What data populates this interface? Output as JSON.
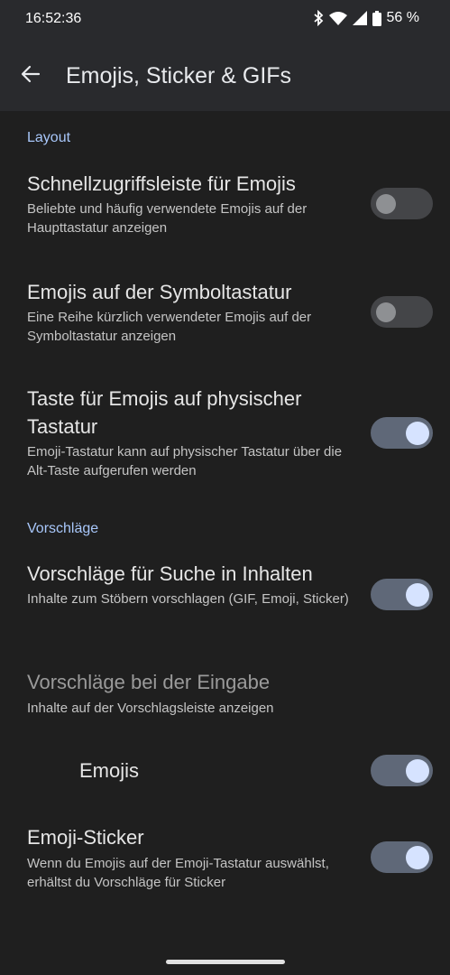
{
  "status": {
    "time": "16:52:36",
    "battery": "56 %",
    "icons": [
      "bluetooth-icon",
      "wifi-icon",
      "signal-icon",
      "battery-icon"
    ]
  },
  "appbar": {
    "title": "Emojis, Sticker & GIFs",
    "back_icon": "arrow-back-icon"
  },
  "sections": {
    "layout": "Layout",
    "suggestions": "Vorschläge"
  },
  "settings": {
    "quick_bar": {
      "title": "Schnellzugriffsleiste für Emojis",
      "desc": "Beliebte und häufig verwendete Emojis auf der Haupttastatur anzeigen",
      "on": false
    },
    "symbol_kb": {
      "title": "Emojis auf der Symboltastatur",
      "desc": "Eine Reihe kürzlich verwendeter Emojis auf der Symboltastatur anzeigen",
      "on": false
    },
    "physical_key": {
      "title": "Taste für Emojis auf physischer Tastatur",
      "desc": "Emoji-Tastatur kann auf physischer Tastatur über die Alt-Taste aufgerufen werden",
      "on": true
    },
    "search_suggest": {
      "title": "Vorschläge für Suche in Inhalten",
      "desc": "Inhalte zum Stöbern vorschlagen (GIF, Emoji, Sticker)",
      "on": true
    },
    "typing_suggest": {
      "title": "Vorschläge bei der Eingabe",
      "desc": "Inhalte auf der Vorschlagsleiste anzeigen"
    },
    "emojis": {
      "title": "Emojis",
      "on": true
    },
    "emoji_sticker": {
      "title": "Emoji-Sticker",
      "desc": "Wenn du Emojis auf der Emoji-Tastatur auswählst, erhältst du Vorschläge für Sticker",
      "on": true
    }
  },
  "colors": {
    "background": "#1f1f1f",
    "appbar": "#292a2d",
    "accent": "#a8c7fa",
    "toggle_on_track": "#5f6878",
    "toggle_on_knob": "#d6e3ff",
    "toggle_off_track": "#444548"
  }
}
